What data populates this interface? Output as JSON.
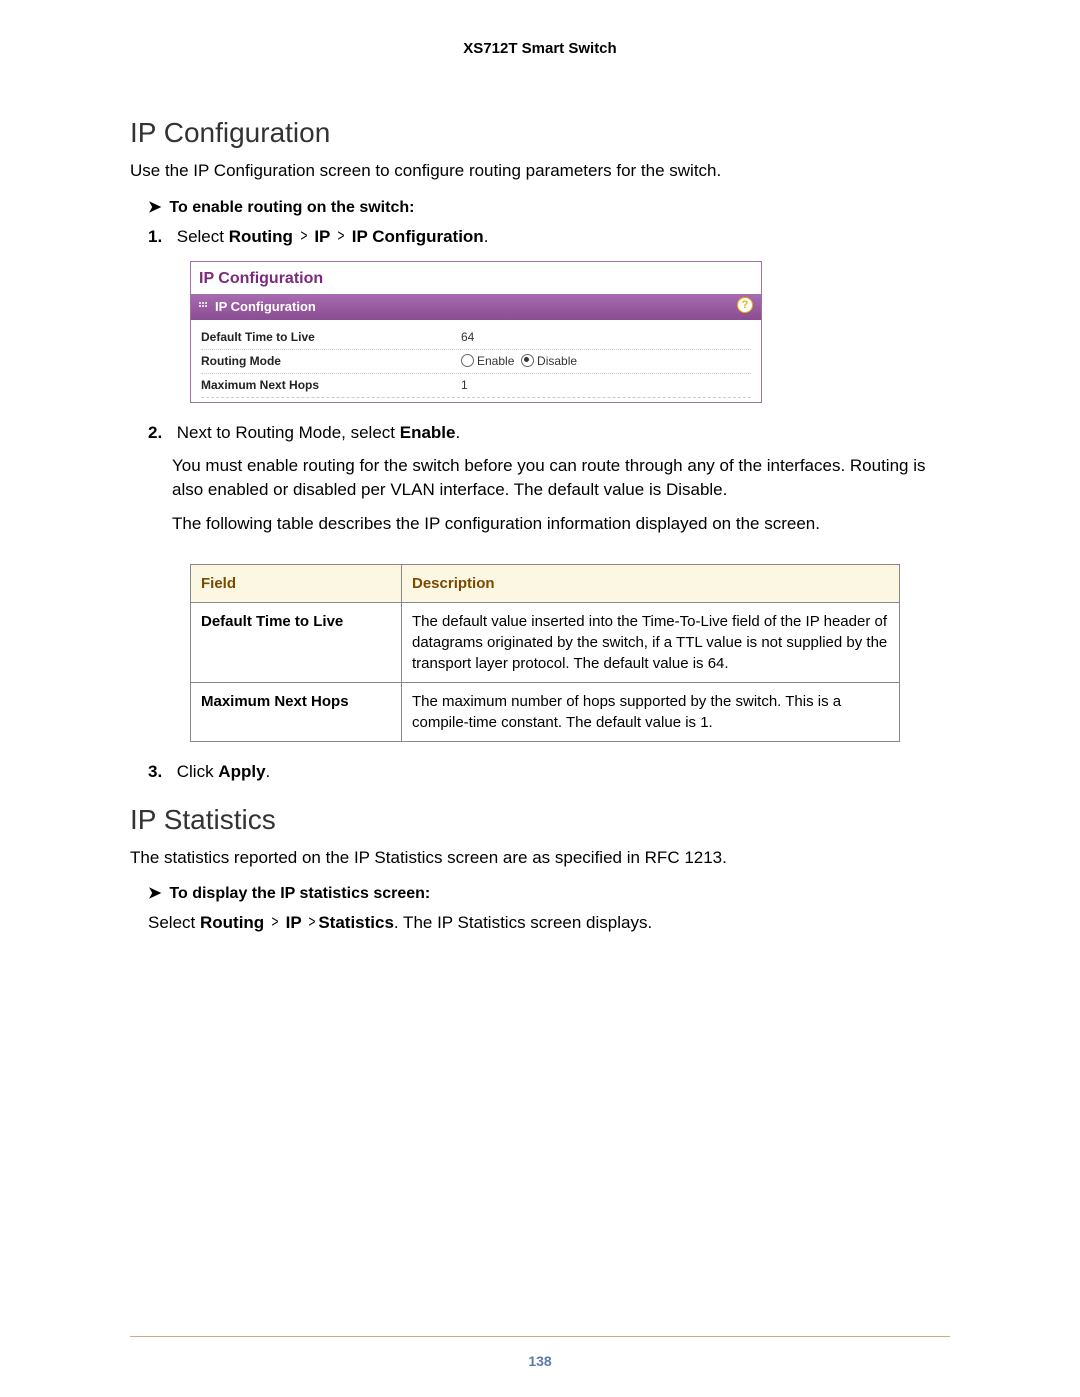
{
  "header": "XS712T Smart Switch",
  "section1": {
    "title": "IP Configuration",
    "intro": "Use the IP Configuration screen to configure routing parameters for the switch.",
    "task_heading": "To enable routing on the switch:",
    "step1_pre": "Select ",
    "step1_bold": "Routing",
    "step1_mid1": "IP",
    "step1_mid2": "IP Configuration",
    "step1_post": "."
  },
  "config_panel": {
    "title": "IP Configuration",
    "subtitle": "IP Configuration",
    "rows": [
      {
        "label": "Default Time to Live",
        "value": "64",
        "type": "text"
      },
      {
        "label": "Routing Mode",
        "enable": "Enable",
        "disable": "Disable",
        "type": "radio"
      },
      {
        "label": "Maximum Next Hops",
        "value": "1",
        "type": "text"
      }
    ]
  },
  "step2": {
    "text_pre": "Next to Routing Mode, select ",
    "text_bold": "Enable",
    "text_post": ".",
    "para1": "You must enable routing for the switch before you can route through any of the interfaces. Routing is also enabled or disabled per VLAN interface. The default value is Disable.",
    "para2": "The following table describes the IP configuration information displayed on the screen."
  },
  "desc_table": {
    "headers": [
      "Field",
      "Description"
    ],
    "rows": [
      {
        "field": "Default Time to Live",
        "desc": "The default value inserted into the Time-To-Live field of the IP header of datagrams originated by the switch, if a TTL value is not supplied by the transport layer protocol. The default value is 64."
      },
      {
        "field": "Maximum Next Hops",
        "desc": "The maximum number of hops supported by the switch. This is a compile-time constant. The default value is 1."
      }
    ]
  },
  "step3": {
    "pre": "Click ",
    "bold": "Apply",
    "post": "."
  },
  "section2": {
    "title": "IP Statistics",
    "intro": "The statistics reported on the IP Statistics screen are as specified in RFC 1213.",
    "task_heading": "To display the IP statistics screen:",
    "select_pre": "Select ",
    "b1": "Routing",
    "b2": "IP",
    "b3": "Statistics",
    "select_post": ". The IP Statistics screen displays."
  },
  "page_number": "138"
}
